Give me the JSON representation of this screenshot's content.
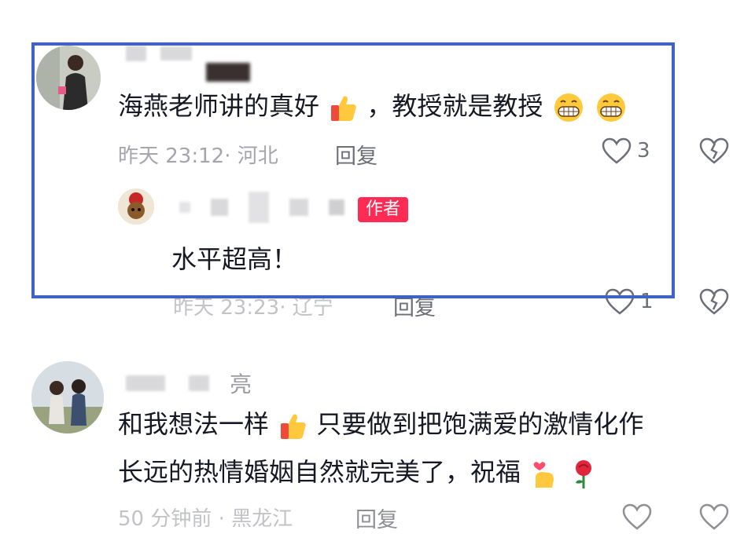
{
  "comments": [
    {
      "text_a": "海燕老师讲的真好",
      "text_b": "，教授就是教授",
      "meta": "昨天 23:12· 河北",
      "reply_label": "回复",
      "likes": "3",
      "reply": {
        "author_badge": "作者",
        "text": "水平超高！",
        "meta": "昨天 23:23· 辽宁",
        "reply_label": "回复",
        "likes": "1"
      }
    },
    {
      "name_suffix": "亮",
      "text_a": "和我想法一样",
      "text_b": "只要做到把饱满爱的激情化作",
      "text_line2": "长远的热情婚姻自然就完美了，祝福",
      "meta": "50 分钟前 · 黑龙江",
      "reply_label": "回复"
    }
  ],
  "icons": [
    "thumbs-up-emoji",
    "grinning-emoji",
    "heart-outline-icon",
    "broken-heart-icon",
    "finger-heart-emoji",
    "rose-emoji"
  ],
  "colors": {
    "highlight_border": "#3f62c5",
    "author_badge": "#fe2c55"
  }
}
